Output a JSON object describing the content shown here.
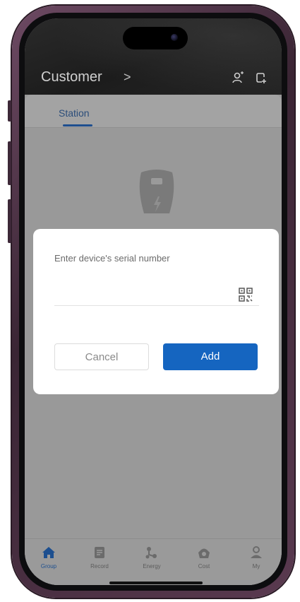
{
  "header": {
    "title": "Customer",
    "chevron": ">",
    "icons": [
      "user-add-icon",
      "device-add-icon"
    ]
  },
  "tabs": [
    {
      "label": "Station",
      "active": true
    }
  ],
  "dialog": {
    "prompt": "Enter device's serial number",
    "input_value": "",
    "cancel_label": "Cancel",
    "add_label": "Add",
    "icon": "qr-scan-icon"
  },
  "bottom_nav": [
    {
      "label": "Group",
      "icon": "home-icon",
      "active": true
    },
    {
      "label": "Record",
      "icon": "record-icon",
      "active": false
    },
    {
      "label": "Energy",
      "icon": "energy-icon",
      "active": false
    },
    {
      "label": "Cost",
      "icon": "cost-icon",
      "active": false
    },
    {
      "label": "My",
      "icon": "profile-icon",
      "active": false
    }
  ],
  "colors": {
    "accent": "#1565c0",
    "active_nav": "#1d4f8f",
    "header_bg": "#1f1f1f",
    "overlay": "#999999"
  }
}
